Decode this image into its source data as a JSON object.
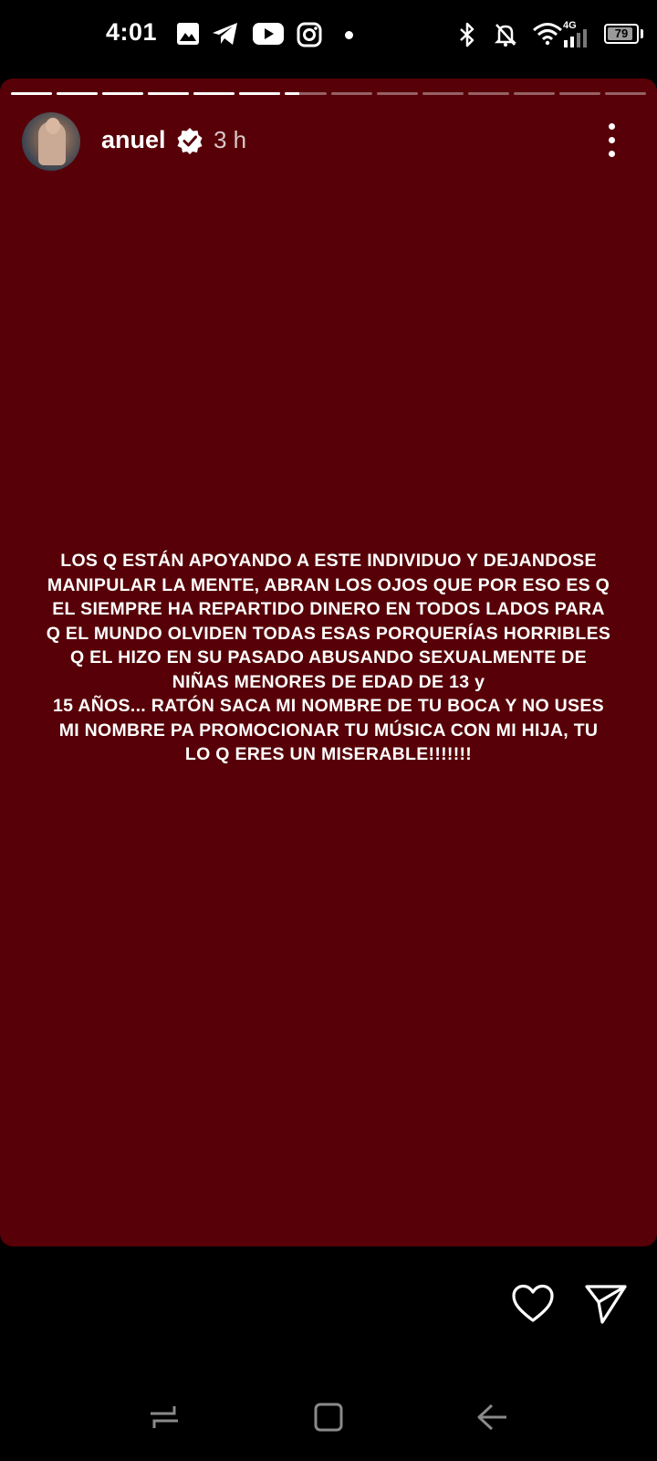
{
  "status_bar": {
    "time": "4:01",
    "network": "4G",
    "battery_level": 79,
    "left_icons": [
      "gallery-icon",
      "telegram-icon",
      "youtube-icon",
      "instagram-icon",
      "dot-icon"
    ],
    "right_icons": [
      "bluetooth-icon",
      "mute-icon",
      "wifi-icon",
      "signal-icon",
      "battery-icon"
    ]
  },
  "story": {
    "background_color": "#570007",
    "progress_segments_total": 14,
    "progress_segments_complete": 6,
    "current_segment_progress": 0.35,
    "username": "anuel",
    "verified": true,
    "time_ago": "3 h",
    "text": "LOS Q ESTÁN APOYANDO A ESTE INDIVIDUO Y DEJANDOSE\nMANIPULAR LA MENTE, ABRAN LOS OJOS QUE POR ESO ES Q\nEL SIEMPRE HA REPARTIDO DINERO EN TODOS LADOS PARA\nQ EL MUNDO OLVIDEN TODAS ESAS PORQUERÍAS HORRIBLES\nQ EL HIZO EN SU PASADO ABUSANDO SEXUALMENTE DE\nNIÑAS MENORES DE EDAD DE 13 y\n15 AÑOS... RATÓN SACA MI NOMBRE DE TU BOCA Y NO USES\nMI NOMBRE PA PROMOCIONAR TU MÚSICA CON MI HIJA, TU\nLO Q ERES UN MISERABLE!!!!!!!"
  },
  "actions": {
    "like_icon": "heart-icon",
    "share_icon": "send-icon"
  },
  "nav_bar": {
    "buttons": [
      "recent-apps-icon",
      "home-icon",
      "back-icon"
    ]
  }
}
